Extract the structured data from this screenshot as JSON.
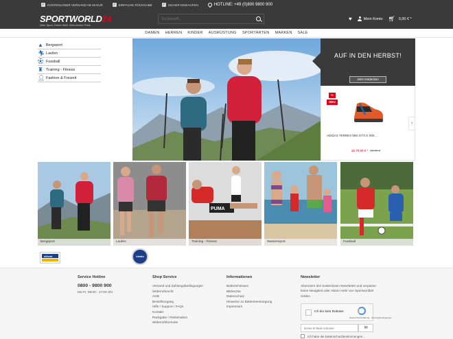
{
  "topbar": {
    "usps": [
      "KOSTENLOSER VERSAND AB 49 EUR",
      "EINFACHE RÜCKGABE",
      "SICHER EINKAUFEN"
    ],
    "hotline": "HOTLINE: +49 (0)800 9800 900"
  },
  "logo": {
    "main_a": "SPORTWORLD",
    "main_b": "24",
    "slogan": "Dein Sport. Deine Welt. Dein bester Preis."
  },
  "search": {
    "placeholder": "Suchbegriff..."
  },
  "header": {
    "account": "Mein Konto",
    "cart_total": "0,00 € *"
  },
  "nav": [
    "DAMEN",
    "HERREN",
    "KINDER",
    "AUSRÜSTUNG",
    "SPORTARTEN",
    "MARKEN",
    "SALE"
  ],
  "categories": [
    {
      "label": "Bergsport",
      "icon": "mountain-icon"
    },
    {
      "label": "Laufen",
      "icon": "runner-icon"
    },
    {
      "label": "Fussball",
      "icon": "football-icon"
    },
    {
      "label": "Training - Fitness",
      "icon": "fitness-icon"
    },
    {
      "label": "Fashion & Freizeit",
      "icon": "fashion-icon"
    }
  ],
  "promo": {
    "title": "AUF IN DEN HERBST!",
    "button": "Jetzt entdecken"
  },
  "product": {
    "badge_percent": "%",
    "badge_new": "NEU",
    "name": "ADIDAS TERREX MID GTX K 000...",
    "price": "ab 79,99 € *",
    "old_price": "99,99 €"
  },
  "tiles": [
    "Bergsport",
    "Laufen",
    "Training - Fitness",
    "Wassersport",
    "Fussball"
  ],
  "badges": {
    "ekomi": "eKomi",
    "idealo": "idealo"
  },
  "footer": {
    "service": {
      "title": "Service Hotline",
      "number": "0800 - 9800 900",
      "hours": "Mo-Fr, 09:00 - 17:00 Uhr"
    },
    "shop": {
      "title": "Shop Service",
      "links": [
        "Versand und Zahlungsbedingungen",
        "Widerrufsrecht",
        "AGB",
        "Bestellvorgang",
        "Hilfe / Support / FAQs",
        "Kontakt",
        "Rückgabe / Reklamation",
        "Widerrufsformular"
      ]
    },
    "info": {
      "title": "Informationen",
      "links": [
        "Batteriehinweis",
        "Bildrechte",
        "Datenschutz",
        "Hinweise zu Batterieentsorgung",
        "Impressum"
      ]
    },
    "newsletter": {
      "title": "Newsletter",
      "text": "Abonniere den kostenlosen Newsletter und verpasse keine Neuigkeit oder Aktion mehr von Sportworld24 GmbH.",
      "captcha": "Ich bin kein Roboter.",
      "captcha_small": "Datenschutzerklärung · Nutzungsbedingungen",
      "placeholder": "Deine E-Mail-Adresse",
      "consent": "Ich habe die Datenschutzbestimmungen..."
    }
  }
}
